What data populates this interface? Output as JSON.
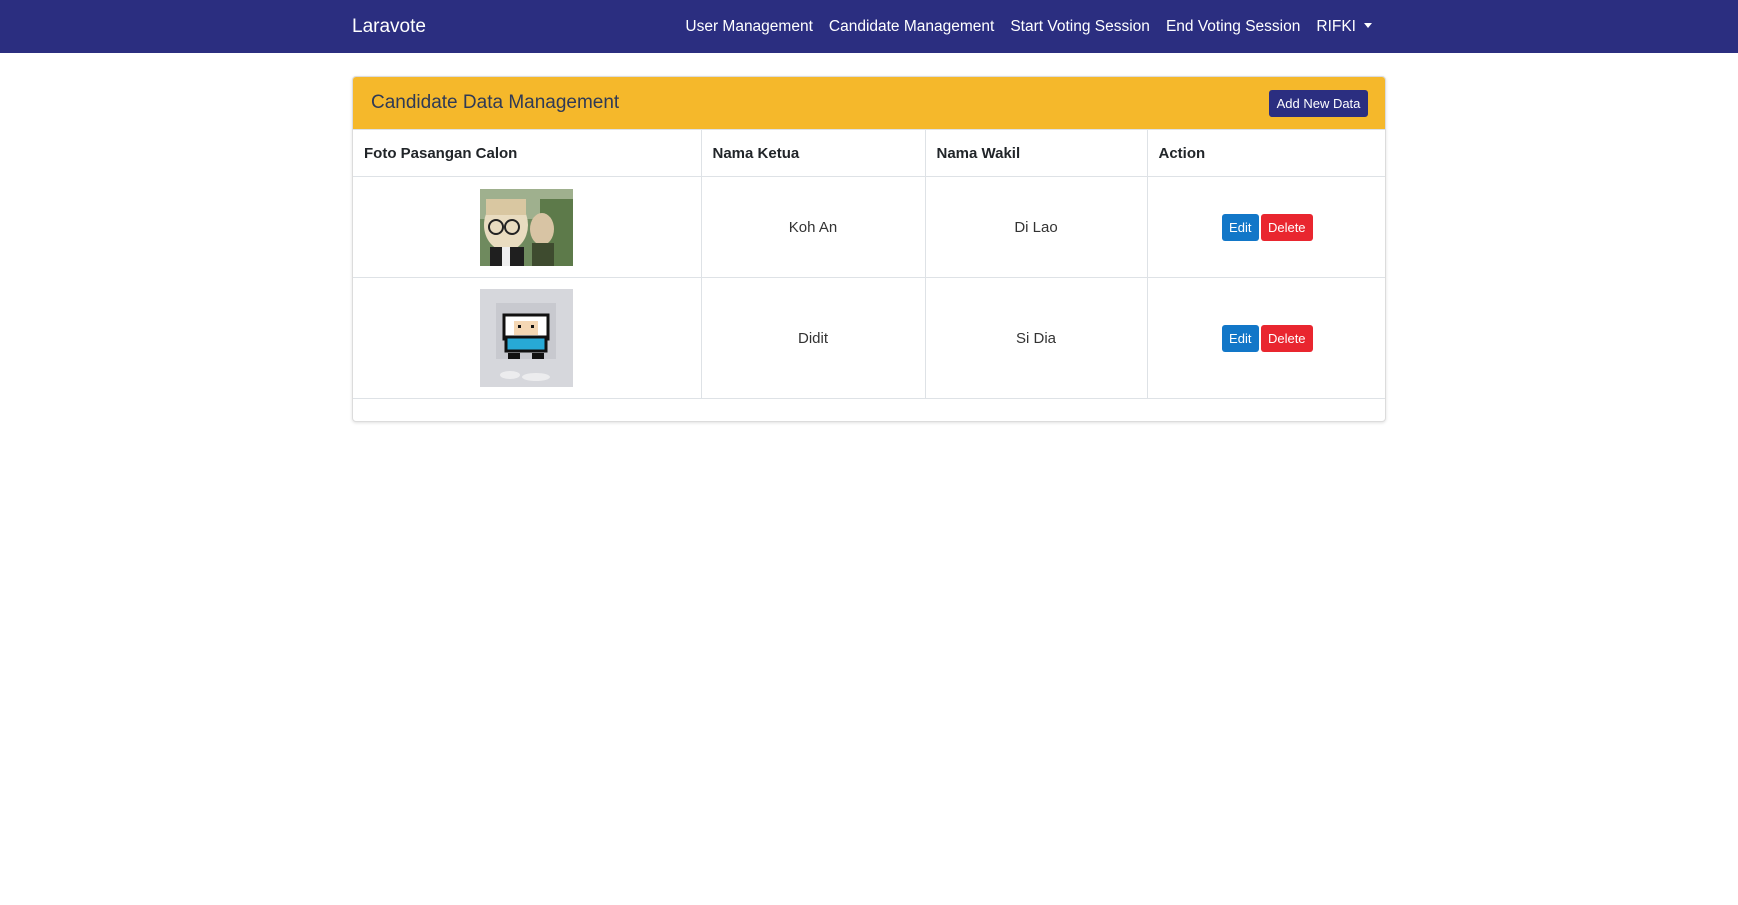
{
  "navbar": {
    "brand": "Laravote",
    "links": [
      {
        "label": "User Management"
      },
      {
        "label": "Candidate Management"
      },
      {
        "label": "Start Voting Session"
      },
      {
        "label": "End Voting Session"
      }
    ],
    "user": "RIFKI"
  },
  "card": {
    "title": "Candidate Data Management",
    "add_button": "Add New Data"
  },
  "table": {
    "headers": [
      "Foto Pasangan Calon",
      "Nama Ketua",
      "Nama Wakil",
      "Action"
    ],
    "rows": [
      {
        "ketua": "Koh An",
        "wakil": "Di Lao",
        "edit": "Edit",
        "delete": "Delete"
      },
      {
        "ketua": "Didit",
        "wakil": "Si Dia",
        "edit": "Edit",
        "delete": "Delete"
      }
    ]
  },
  "colors": {
    "navbar": "#2b2e80",
    "card_header": "#f5b82b",
    "edit_button": "#1277c8",
    "delete_button": "#e9262f"
  }
}
